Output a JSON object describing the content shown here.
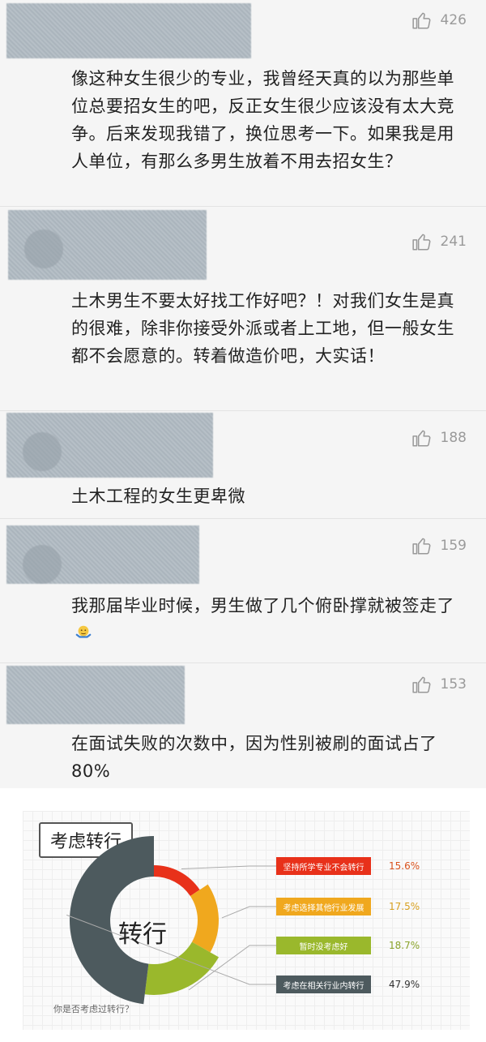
{
  "comments": [
    {
      "likes": "426",
      "text": "像这种女生很少的专业，我曾经天真的以为那些单位总要招女生的吧，反正女生很少应该没有太大竞争。后来发现我错了，换位思考一下。如果我是用人单位，有那么多男生放着不用去招女生？"
    },
    {
      "likes": "241",
      "text": "土木男生不要太好找工作好吧？！对我们女生是真的很难，除非你接受外派或者上工地，但一般女生都不会愿意的。转着做造价吧，大实话！"
    },
    {
      "likes": "188",
      "text": "土木工程的女生更卑微"
    },
    {
      "likes": "159",
      "text": "我那届毕业时候，男生做了几个俯卧撑就被签走了"
    },
    {
      "likes": "153",
      "text": "在面试失败的次数中，因为性别被刷的面试占了80%"
    }
  ],
  "icons": {
    "like": "thumbs-up-icon",
    "emoji": "shrug-emoji-icon"
  },
  "chart": {
    "title": "考虑转行",
    "center_label": "转行",
    "question": "你是否考虑过转行？",
    "chart_data": {
      "type": "pie",
      "categories": [
        "坚持所学专业不会转行",
        "考虑选择其他行业发展",
        "暂时没考虑好",
        "考虑在相关行业内转行"
      ],
      "values": [
        15.6,
        17.5,
        18.7,
        47.9
      ],
      "labels": [
        "15.6%",
        "17.5%",
        "18.7%",
        "47.9%"
      ],
      "colors": [
        "#e8311a",
        "#f0a81e",
        "#9ab82c",
        "#4d5a5e"
      ],
      "label_colors": [
        "#d9531e",
        "#d8a020",
        "#8aa32a",
        "#333333"
      ]
    }
  }
}
